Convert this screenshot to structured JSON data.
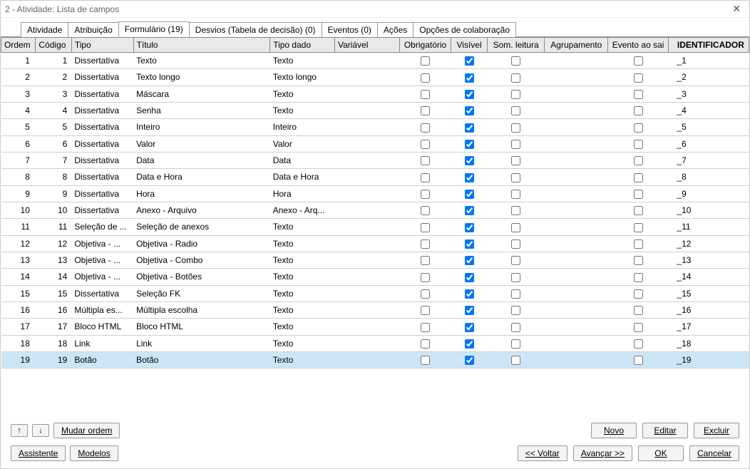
{
  "title": "2 - Atividade: Lista de campos",
  "tabs": [
    {
      "label": "Atividade"
    },
    {
      "label": "Atribuição"
    },
    {
      "label": "Formulário (19)",
      "active": true
    },
    {
      "label": "Desvios (Tabela de decisão) (0)"
    },
    {
      "label": "Eventos (0)"
    },
    {
      "label": "Ações"
    },
    {
      "label": "Opções de colaboração"
    }
  ],
  "columns": {
    "ordem": "Ordem",
    "codigo": "Código",
    "tipo": "Tipo",
    "titulo": "Título",
    "tipodado": "Tipo dado",
    "variavel": "Variável",
    "obrigatorio": "Obrigatório",
    "visivel": "Visível",
    "somleitura": "Som. leitura",
    "agrupamento": "Agrupamento",
    "eventoaosair": "Evento ao sai",
    "identificador": "IDENTIFICADOR"
  },
  "rows": [
    {
      "ordem": "1",
      "codigo": "1",
      "tipo": "Dissertativa",
      "titulo": "Texto",
      "tipodado": "Texto",
      "obrig": false,
      "vis": true,
      "som": false,
      "evento": false,
      "ident": "_1"
    },
    {
      "ordem": "2",
      "codigo": "2",
      "tipo": "Dissertativa",
      "titulo": "Texto longo",
      "tipodado": "Texto longo",
      "obrig": false,
      "vis": true,
      "som": false,
      "evento": false,
      "ident": "_2"
    },
    {
      "ordem": "3",
      "codigo": "3",
      "tipo": "Dissertativa",
      "titulo": "Máscara",
      "tipodado": "Texto",
      "obrig": false,
      "vis": true,
      "som": false,
      "evento": false,
      "ident": "_3"
    },
    {
      "ordem": "4",
      "codigo": "4",
      "tipo": "Dissertativa",
      "titulo": "Senha",
      "tipodado": "Texto",
      "obrig": false,
      "vis": true,
      "som": false,
      "evento": false,
      "ident": "_4"
    },
    {
      "ordem": "5",
      "codigo": "5",
      "tipo": "Dissertativa",
      "titulo": "Inteiro",
      "tipodado": "Inteiro",
      "obrig": false,
      "vis": true,
      "som": false,
      "evento": false,
      "ident": "_5"
    },
    {
      "ordem": "6",
      "codigo": "6",
      "tipo": "Dissertativa",
      "titulo": "Valor",
      "tipodado": "Valor",
      "obrig": false,
      "vis": true,
      "som": false,
      "evento": false,
      "ident": "_6"
    },
    {
      "ordem": "7",
      "codigo": "7",
      "tipo": "Dissertativa",
      "titulo": "Data",
      "tipodado": "Data",
      "obrig": false,
      "vis": true,
      "som": false,
      "evento": false,
      "ident": "_7"
    },
    {
      "ordem": "8",
      "codigo": "8",
      "tipo": "Dissertativa",
      "titulo": "Data e Hora",
      "tipodado": "Data e Hora",
      "obrig": false,
      "vis": true,
      "som": false,
      "evento": false,
      "ident": "_8"
    },
    {
      "ordem": "9",
      "codigo": "9",
      "tipo": "Dissertativa",
      "titulo": "Hora",
      "tipodado": "Hora",
      "obrig": false,
      "vis": true,
      "som": false,
      "evento": false,
      "ident": "_9"
    },
    {
      "ordem": "10",
      "codigo": "10",
      "tipo": "Dissertativa",
      "titulo": "Anexo - Arquivo",
      "tipodado": "Anexo - Arq...",
      "obrig": false,
      "vis": true,
      "som": false,
      "evento": false,
      "ident": "_10"
    },
    {
      "ordem": "11",
      "codigo": "11",
      "tipo": "Seleção de ...",
      "titulo": "Seleção de anexos",
      "tipodado": "Texto",
      "obrig": false,
      "vis": true,
      "som": false,
      "evento": false,
      "ident": "_11"
    },
    {
      "ordem": "12",
      "codigo": "12",
      "tipo": "Objetiva - ...",
      "titulo": "Objetiva - Radio",
      "tipodado": "Texto",
      "obrig": false,
      "vis": true,
      "som": false,
      "evento": false,
      "ident": "_12"
    },
    {
      "ordem": "13",
      "codigo": "13",
      "tipo": "Objetiva - ...",
      "titulo": "Objetiva - Combo",
      "tipodado": "Texto",
      "obrig": false,
      "vis": true,
      "som": false,
      "evento": false,
      "ident": "_13"
    },
    {
      "ordem": "14",
      "codigo": "14",
      "tipo": "Objetiva - ...",
      "titulo": "Objetiva - Botões",
      "tipodado": "Texto",
      "obrig": false,
      "vis": true,
      "som": false,
      "evento": false,
      "ident": "_14"
    },
    {
      "ordem": "15",
      "codigo": "15",
      "tipo": "Dissertativa",
      "titulo": "Seleção FK",
      "tipodado": "Texto",
      "obrig": false,
      "vis": true,
      "som": false,
      "evento": false,
      "ident": "_15"
    },
    {
      "ordem": "16",
      "codigo": "16",
      "tipo": "Múltipla es...",
      "titulo": "Múltipla escolha",
      "tipodado": "Texto",
      "obrig": false,
      "vis": true,
      "som": false,
      "evento": false,
      "ident": "_16"
    },
    {
      "ordem": "17",
      "codigo": "17",
      "tipo": "Bloco HTML",
      "titulo": "Bloco HTML",
      "tipodado": "Texto",
      "obrig": false,
      "vis": true,
      "som": false,
      "evento": false,
      "ident": "_17"
    },
    {
      "ordem": "18",
      "codigo": "18",
      "tipo": "Link",
      "titulo": "Link",
      "tipodado": "Texto",
      "obrig": false,
      "vis": true,
      "som": false,
      "evento": false,
      "ident": "_18"
    },
    {
      "ordem": "19",
      "codigo": "19",
      "tipo": "Botão",
      "titulo": "Botão",
      "tipodado": "Texto",
      "obrig": false,
      "vis": true,
      "som": false,
      "evento": false,
      "ident": "_19",
      "selected": true
    }
  ],
  "buttons": {
    "up": "↑",
    "down": "↓",
    "mudar_ordem": "Mudar ordem",
    "novo": "Novo",
    "editar": "Editar",
    "excluir": "Excluir",
    "assistente": "Assistente",
    "modelos": "Modelos",
    "voltar": "<< Voltar",
    "avancar": "Avançar >>",
    "ok": "OK",
    "cancelar": "Cancelar"
  }
}
